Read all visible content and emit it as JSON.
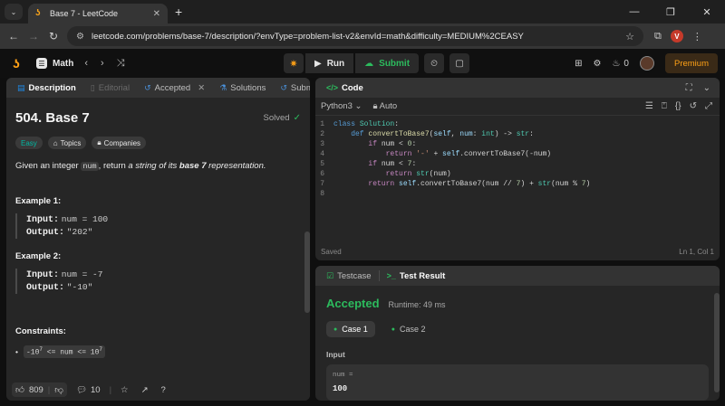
{
  "browser": {
    "tab_title": "Base 7 - LeetCode",
    "url": "leetcode.com/problems/base-7/description/?envType=problem-list-v2&envId=math&difficulty=MEDIUM%2CEASY",
    "profile_initial": "V"
  },
  "nav": {
    "problem_list": "Math",
    "run": "Run",
    "submit": "Submit",
    "streak_count": "0",
    "premium": "Premium"
  },
  "left_tabs": [
    {
      "label": "Description"
    },
    {
      "label": "Editorial"
    },
    {
      "label": "Accepted"
    },
    {
      "label": "Solutions"
    },
    {
      "label": "Submissions"
    }
  ],
  "problem": {
    "title": "504. Base 7",
    "status": "Solved",
    "difficulty": "Easy",
    "topics": "Topics",
    "companies": "Companies",
    "statement_pre": "Given an integer ",
    "statement_code": "num",
    "statement_mid": ", return ",
    "statement_em": "a string of its ",
    "statement_bold": "base 7",
    "statement_post": " representation.",
    "example1_title": "Example 1:",
    "example1_input_label": "Input:",
    "example1_input_value": "num = 100",
    "example1_output_label": "Output:",
    "example1_output_value": "\"202\"",
    "example2_title": "Example 2:",
    "example2_input_label": "Input:",
    "example2_input_value": "num = -7",
    "example2_output_label": "Output:",
    "example2_output_value": "\"-10\"",
    "constraints_title": "Constraints:",
    "constraint_text_a": "-10",
    "constraint_exp_a": "7",
    "constraint_text_b": " <= num <= 10",
    "constraint_exp_b": "7"
  },
  "left_footer": {
    "likes": "809",
    "comments": "10"
  },
  "code": {
    "panel_title": "Code",
    "language": "Python3",
    "autosave": "Auto",
    "lines": [
      "class Solution:",
      "    def convertToBase7(self, num: int) -> str:",
      "        if num < 0:",
      "            return '-' + self.convertToBase7(-num)",
      "        if num < 7:",
      "            return str(num)",
      "        return self.convertToBase7(num // 7) + str(num % 7)",
      ""
    ],
    "status_saved": "Saved",
    "cursor": "Ln 1, Col 1"
  },
  "result": {
    "tab_testcase": "Testcase",
    "tab_result": "Test Result",
    "verdict": "Accepted",
    "runtime": "Runtime: 49 ms",
    "case1": "Case 1",
    "case2": "Case 2",
    "input_label": "Input",
    "var_name": "num =",
    "var_value": "100"
  },
  "colors": {
    "accent_orange": "#ffa116",
    "accepted_green": "#2cbb5d",
    "easy_teal": "#00b8a3"
  }
}
